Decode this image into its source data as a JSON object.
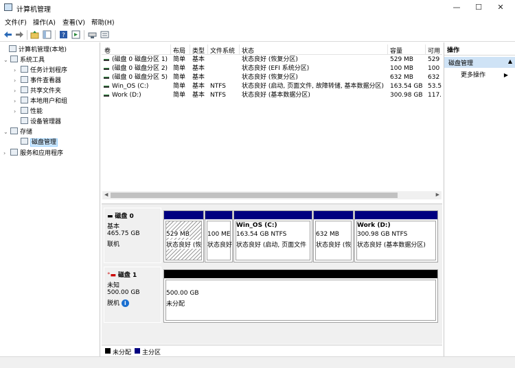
{
  "window": {
    "title": "计算机管理",
    "min": "—",
    "max": "☐",
    "close": "✕"
  },
  "menu": [
    "文件(F)",
    "操作(A)",
    "查看(V)",
    "帮助(H)"
  ],
  "tree": [
    {
      "label": "计算机管理(本地)",
      "exp": "",
      "level": 0,
      "icon": "computer-mgmt-icon"
    },
    {
      "label": "系统工具",
      "exp": "⌄",
      "level": 1,
      "icon": "tools-icon"
    },
    {
      "label": "任务计划程序",
      "exp": "›",
      "level": 2,
      "icon": "clock-icon"
    },
    {
      "label": "事件查看器",
      "exp": "›",
      "level": 2,
      "icon": "event-viewer-icon"
    },
    {
      "label": "共享文件夹",
      "exp": "›",
      "level": 2,
      "icon": "shared-folder-icon"
    },
    {
      "label": "本地用户和组",
      "exp": "›",
      "level": 2,
      "icon": "users-icon"
    },
    {
      "label": "性能",
      "exp": "›",
      "level": 2,
      "icon": "performance-icon"
    },
    {
      "label": "设备管理器",
      "exp": "",
      "level": 2,
      "icon": "device-manager-icon"
    },
    {
      "label": "存储",
      "exp": "⌄",
      "level": 1,
      "icon": "storage-icon"
    },
    {
      "label": "磁盘管理",
      "exp": "",
      "level": 2,
      "icon": "disk-mgmt-icon",
      "selected": true
    },
    {
      "label": "服务和应用程序",
      "exp": "›",
      "level": 1,
      "icon": "services-icon"
    }
  ],
  "volume_table": {
    "headers": [
      "卷",
      "布局",
      "类型",
      "文件系统",
      "状态",
      "容量",
      "可用"
    ],
    "rows": [
      [
        "(磁盘 0 磁盘分区 1)",
        "简单",
        "基本",
        "",
        "状态良好 (恢复分区)",
        "529 MB",
        "529"
      ],
      [
        "(磁盘 0 磁盘分区 2)",
        "简单",
        "基本",
        "",
        "状态良好 (EFI 系统分区)",
        "100 MB",
        "100"
      ],
      [
        "(磁盘 0 磁盘分区 5)",
        "简单",
        "基本",
        "",
        "状态良好 (恢复分区)",
        "632 MB",
        "632"
      ],
      [
        "Win_OS (C:)",
        "简单",
        "基本",
        "NTFS",
        "状态良好 (启动, 页面文件, 故障转储, 基本数据分区)",
        "163.54 GB",
        "53.5"
      ],
      [
        "Work (D:)",
        "简单",
        "基本",
        "NTFS",
        "状态良好 (基本数据分区)",
        "300.98 GB",
        "117."
      ]
    ]
  },
  "disks": [
    {
      "name": "磁盘 0",
      "type": "基本",
      "size": "465.75 GB",
      "status": "联机",
      "partitions": [
        {
          "title": "",
          "size": "529 MB",
          "status": "状态良好 (恢"
        },
        {
          "title": "",
          "size": "100 ME",
          "status": "状态良好"
        },
        {
          "title": "Win_OS  (C:)",
          "size": "163.54 GB NTFS",
          "status": "状态良好 (启动, 页面文件"
        },
        {
          "title": "",
          "size": "632 MB",
          "status": "状态良好 (恢"
        },
        {
          "title": "Work  (D:)",
          "size": "300.98 GB NTFS",
          "status": "状态良好 (基本数据分区)"
        }
      ]
    },
    {
      "name": "磁盘 1",
      "type": "未知",
      "size": "500.00 GB",
      "status": "脱机",
      "partitions": [
        {
          "title": "",
          "size": "500.00 GB",
          "status": "未分配"
        }
      ]
    }
  ],
  "legend": [
    {
      "label": "未分配",
      "color": "#000000"
    },
    {
      "label": "主分区",
      "color": "#000080"
    }
  ],
  "actions": {
    "header": "操作",
    "section": "磁盘管理",
    "more": "更多操作"
  }
}
